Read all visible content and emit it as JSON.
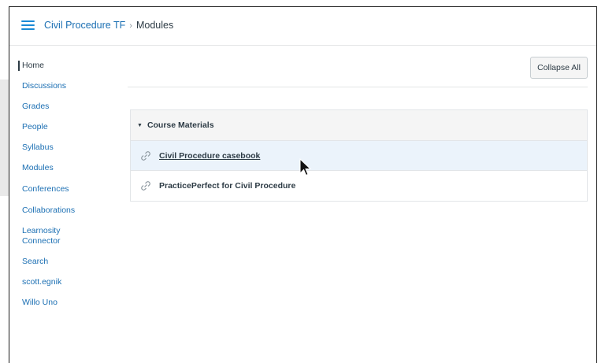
{
  "header": {
    "course_name": "Civil Procedure TF",
    "separator": "›",
    "current_page": "Modules"
  },
  "sidebar": {
    "items": [
      {
        "label": "Home",
        "active": true
      },
      {
        "label": "Discussions"
      },
      {
        "label": "Grades"
      },
      {
        "label": "People"
      },
      {
        "label": "Syllabus"
      },
      {
        "label": "Modules"
      },
      {
        "label": "Conferences"
      },
      {
        "label": "Collaborations"
      },
      {
        "label": "Learnosity Connector"
      },
      {
        "label": "Search"
      },
      {
        "label": "scott.egnik"
      },
      {
        "label": "Willo Uno"
      }
    ]
  },
  "toolbar": {
    "collapse_all_label": "Collapse All"
  },
  "module": {
    "title": "Course Materials",
    "items": [
      {
        "title": "Civil Procedure casebook",
        "icon": "link-icon"
      },
      {
        "title": "PracticePerfect for Civil Procedure",
        "icon": "link-icon"
      }
    ]
  },
  "colors": {
    "link": "#1b6fb3",
    "text": "#2d3b45",
    "hover_row": "#ebf3fb",
    "module_header": "#f5f5f5"
  }
}
